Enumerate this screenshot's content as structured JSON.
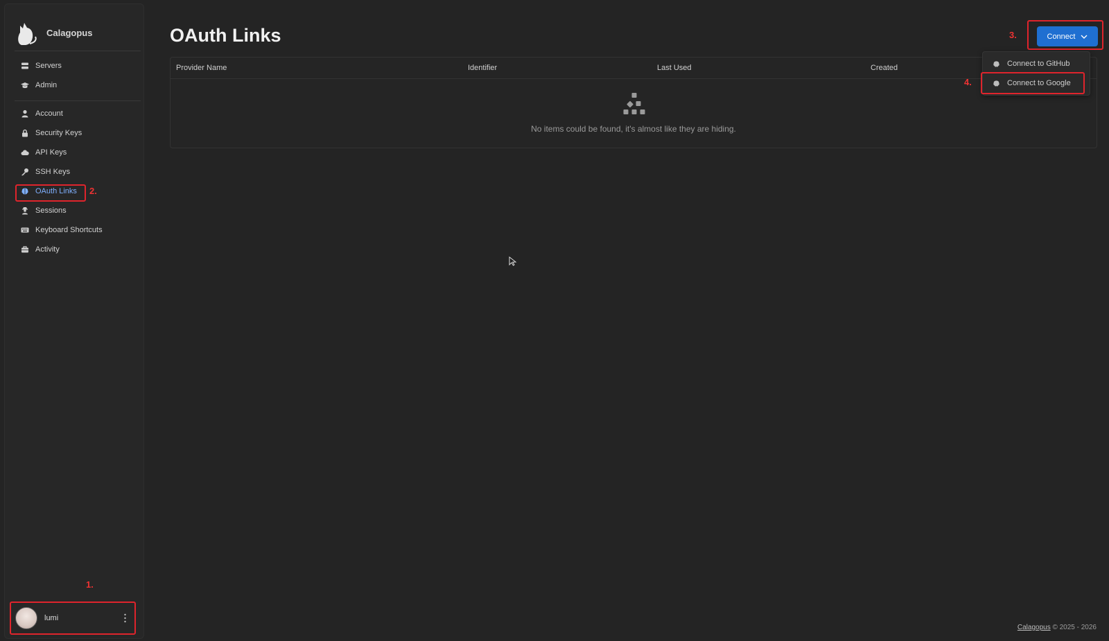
{
  "app": {
    "name": "Calagopus"
  },
  "sidebar": {
    "items": [
      {
        "label": "Servers",
        "icon": "server-icon"
      },
      {
        "label": "Admin",
        "icon": "graduation-cap-icon"
      },
      {
        "label": "Account",
        "icon": "user-icon"
      },
      {
        "label": "Security Keys",
        "icon": "lock-icon"
      },
      {
        "label": "API Keys",
        "icon": "cloud-icon"
      },
      {
        "label": "SSH Keys",
        "icon": "key-icon"
      },
      {
        "label": "OAuth Links",
        "icon": "brain-icon",
        "active": true
      },
      {
        "label": "Sessions",
        "icon": "user-secret-icon"
      },
      {
        "label": "Keyboard Shortcuts",
        "icon": "keyboard-icon"
      },
      {
        "label": "Activity",
        "icon": "briefcase-icon"
      }
    ]
  },
  "user": {
    "name": "lumi"
  },
  "page": {
    "title": "OAuth Links",
    "connect_label": "Connect",
    "table": {
      "columns": [
        "Provider Name",
        "Identifier",
        "Last Used",
        "Created"
      ],
      "empty_message": "No items could be found, it's almost like they are hiding."
    },
    "dropdown": [
      {
        "label": "Connect to GitHub",
        "icon": "brain-icon"
      },
      {
        "label": "Connect to Google",
        "icon": "brain-icon"
      }
    ]
  },
  "annotations": {
    "m1": "1.",
    "m2": "2.",
    "m3": "3.",
    "m4": "4."
  },
  "footer": {
    "link": "Calagopus",
    "copyright": "© 2025 - 2026"
  },
  "colors": {
    "accent": "#1f6fd1",
    "active_text": "#7fb0ff",
    "annotation": "#e0242c"
  }
}
